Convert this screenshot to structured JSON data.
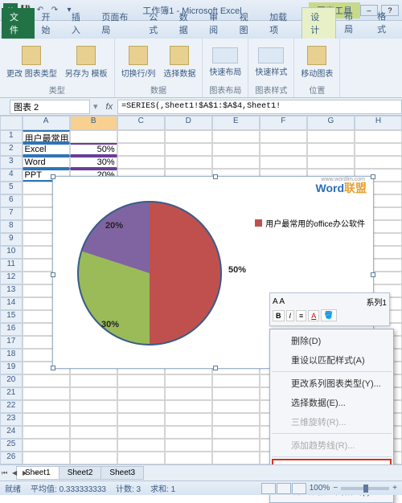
{
  "window": {
    "title": "工作簿1 - Microsoft Excel",
    "context_title": "图表工具"
  },
  "tabs": {
    "file": "文件",
    "home": "开始",
    "insert": "插入",
    "layout": "页面布局",
    "formulas": "公式",
    "data": "数据",
    "review": "审阅",
    "view": "视图",
    "addins": "加载项",
    "design": "设计",
    "chart_layout": "布局",
    "format": "格式"
  },
  "ribbon": {
    "g1_btn1": "更改\n图表类型",
    "g1_btn2": "另存为\n模板",
    "g1_label": "类型",
    "g2_btn1": "切换行/列",
    "g2_btn2": "选择数据",
    "g2_label": "数据",
    "g3_btn1": "快速布局",
    "g3_label": "图表布局",
    "g4_btn1": "快速样式",
    "g4_label": "图表样式",
    "g5_btn1": "移动图表",
    "g5_label": "位置"
  },
  "namebox": "图表 2",
  "formula": "=SERIES(,Sheet1!$A$1:$A$4,Sheet1!",
  "fx": "fx",
  "columns": [
    "A",
    "B",
    "C",
    "D",
    "E",
    "F",
    "G",
    "H"
  ],
  "grid": {
    "r1c1": "用户最常用的office办公软件",
    "r2c1": "Excel",
    "r2c2": "50%",
    "r3c1": "Word",
    "r3c2": "30%",
    "r4c1": "PPT",
    "r4c2": "20%"
  },
  "chart_data": {
    "type": "pie",
    "title": "用户最常用的office办公软件",
    "categories": [
      "Excel",
      "Word",
      "PPT"
    ],
    "values": [
      50,
      30,
      20
    ],
    "labels": [
      "50%",
      "30%",
      "20%"
    ],
    "colors": [
      "#c0504d",
      "#9bbb59",
      "#8064a2"
    ],
    "legend_position": "right"
  },
  "legend_text": "用户最常用的office办公软件",
  "watermark": {
    "w": "Word",
    "lm": "联盟",
    "url": "www.wordlm.com"
  },
  "mini_toolbar": {
    "series": "系列1",
    "font_sample": "A  A"
  },
  "context_menu": {
    "delete": "删除(D)",
    "reset": "重设以匹配样式(A)",
    "change_type": "更改系列图表类型(Y)...",
    "select_data": "选择数据(E)...",
    "rotate3d": "三维旋转(R)...",
    "trendline": "添加趋势线(R)...",
    "format_labels": "设置数据标签格式(B)...",
    "format_series": "设置数据系列格式(I)..."
  },
  "sheets": {
    "s1": "Sheet1",
    "s2": "Sheet2",
    "s3": "Sheet3"
  },
  "status": {
    "ready": "就绪",
    "avg_label": "平均值:",
    "avg": "0.333333333",
    "count_label": "计数:",
    "count": "3",
    "sum_label": "求和:",
    "sum": "1",
    "zoom": "100%"
  }
}
